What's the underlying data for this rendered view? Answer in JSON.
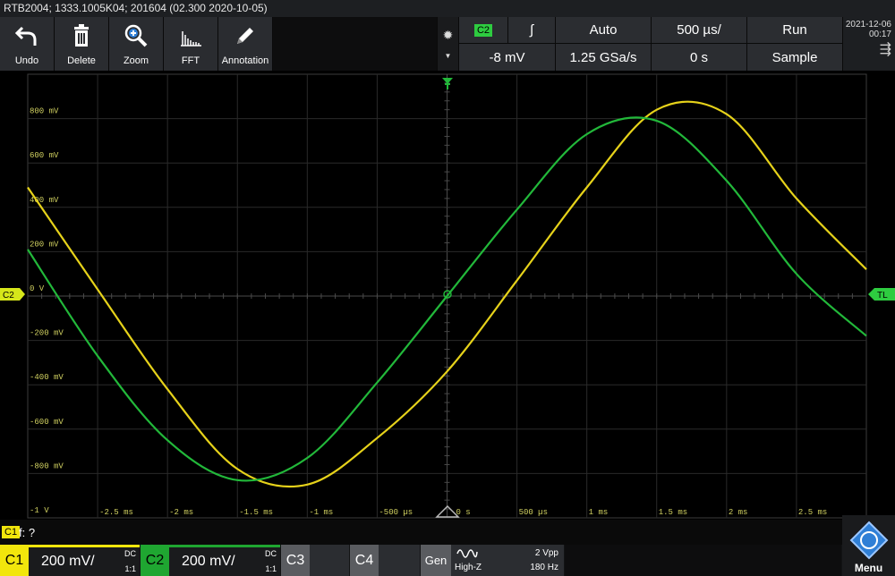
{
  "window": {
    "title": "RTB2004; 1333.1005K04; 201604 (02.300 2020-10-05)"
  },
  "toolbar": {
    "undo": "Undo",
    "delete": "Delete",
    "zoom": "Zoom",
    "fft": "FFT",
    "annotation": "Annotation"
  },
  "status": {
    "trigger_source": "C2",
    "trigger_slope": "∫",
    "trigger_mode": "Auto",
    "timebase": "500 µs/",
    "run_state": "Run",
    "trigger_level": "-8 mV",
    "sample_rate": "1.25 GSa/s",
    "horizontal_position": "0 s",
    "acquisition_mode": "Sample"
  },
  "clock": {
    "date": "2021-12-06",
    "time": "00:17"
  },
  "screen": {
    "y_labels": [
      "800 mV",
      "600 mV",
      "400 mV",
      "200 mV",
      "0 V",
      "-200 mV",
      "-400 mV",
      "-600 mV",
      "-800 mV",
      "-1 V"
    ],
    "x_labels": [
      "-2.5 ms",
      "-2 ms",
      "-1.5 ms",
      "-1 ms",
      "-500 µs",
      "0 s",
      "500 µs",
      "1 ms",
      "1.5 ms",
      "2 ms",
      "2.5 ms"
    ],
    "left_marker": "C2",
    "right_marker": "TL"
  },
  "chart_data": {
    "type": "line",
    "xlabel": "",
    "ylabel": "",
    "xlim": [
      -3.0,
      3.0
    ],
    "ylim": [
      -1.0,
      1.0
    ],
    "x_unit": "ms",
    "y_unit": "V",
    "grid": true,
    "series": [
      {
        "name": "C1",
        "color": "#e6d21a",
        "x": [
          -3.0,
          -2.5,
          -2.0,
          -1.5,
          -1.0,
          -0.5,
          0.0,
          0.5,
          1.0,
          1.5,
          2.0,
          2.5,
          3.0
        ],
        "y": [
          0.49,
          0.03,
          -0.42,
          -0.78,
          -0.85,
          -0.64,
          -0.34,
          0.07,
          0.49,
          0.84,
          0.82,
          0.44,
          0.12
        ]
      },
      {
        "name": "C2",
        "color": "#22b83a",
        "x": [
          -3.0,
          -2.5,
          -2.0,
          -1.5,
          -1.0,
          -0.5,
          0.0,
          0.5,
          1.0,
          1.5,
          2.0,
          2.5,
          3.0
        ],
        "y": [
          0.21,
          -0.27,
          -0.65,
          -0.83,
          -0.73,
          -0.39,
          0.0,
          0.39,
          0.73,
          0.79,
          0.52,
          0.1,
          -0.18
        ]
      }
    ]
  },
  "info": {
    "channel": "C1",
    "formula": "f: ?"
  },
  "channels": {
    "c1": {
      "name": "C1",
      "scale": "200 mV/",
      "coupling": "DC",
      "probe": "1:1",
      "color": "#f2e60c"
    },
    "c2": {
      "name": "C2",
      "scale": "200 mV/",
      "coupling": "DC",
      "probe": "1:1",
      "color": "#1fa631"
    },
    "c3": {
      "name": "C3"
    },
    "c4": {
      "name": "C4"
    }
  },
  "generator": {
    "label": "Gen",
    "impedance": "High-Z",
    "amplitude": "2 Vpp",
    "frequency": "180 Hz"
  },
  "menu": {
    "label": "Menu"
  }
}
